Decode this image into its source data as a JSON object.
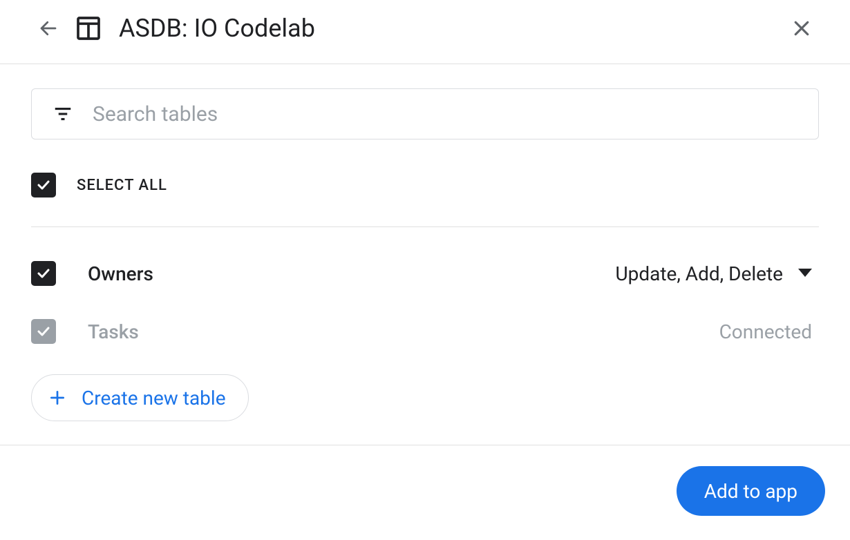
{
  "header": {
    "title": "ASDB: IO Codelab"
  },
  "search": {
    "placeholder": "Search tables"
  },
  "select_all": {
    "label": "SELECT ALL",
    "checked": true
  },
  "tables": [
    {
      "name": "Owners",
      "checked": true,
      "disabled": false,
      "status": "Update, Add, Delete",
      "has_dropdown": true
    },
    {
      "name": "Tasks",
      "checked": true,
      "disabled": true,
      "status": "Connected",
      "has_dropdown": false
    }
  ],
  "actions": {
    "create_table": "Create new table",
    "add_to_app": "Add to app"
  }
}
